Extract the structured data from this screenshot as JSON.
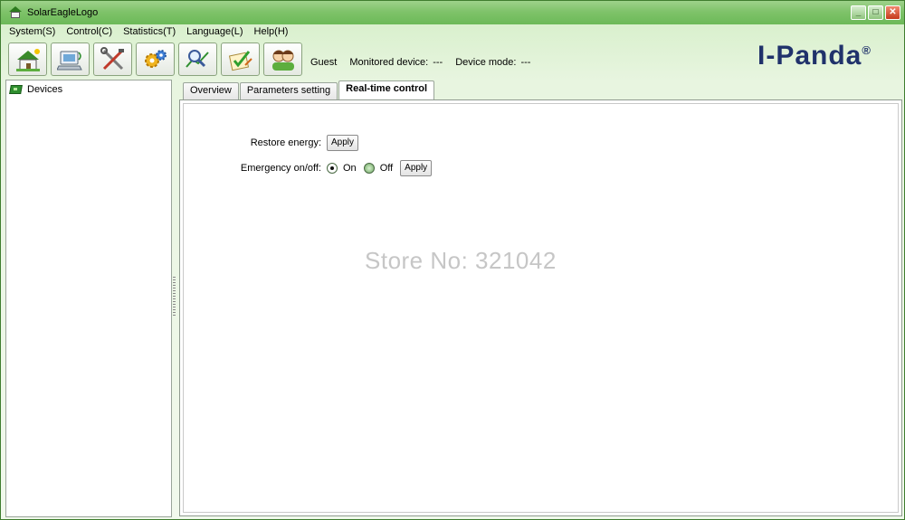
{
  "window": {
    "title": "SolarEagleLogo"
  },
  "window_controls": [
    "minimize",
    "maximize",
    "close"
  ],
  "menu": [
    {
      "label": "System(S)"
    },
    {
      "label": "Control(C)"
    },
    {
      "label": "Statistics(T)"
    },
    {
      "label": "Language(L)"
    },
    {
      "label": "Help(H)"
    }
  ],
  "toolbar": [
    {
      "icon": "solar-house-icon"
    },
    {
      "icon": "monitor-device-icon"
    },
    {
      "icon": "tools-icon"
    },
    {
      "icon": "settings-gears-icon"
    },
    {
      "icon": "search-chart-icon"
    },
    {
      "icon": "checklist-icon"
    },
    {
      "icon": "users-icon"
    }
  ],
  "status": {
    "user": "Guest",
    "monitored_label": "Monitored device:",
    "monitored_value": "---",
    "mode_label": "Device mode:",
    "mode_value": "---"
  },
  "brand": {
    "name": "I-Panda",
    "mark": "®"
  },
  "tree": {
    "root_label": "Devices"
  },
  "tabs": [
    {
      "label": "Overview",
      "active": false
    },
    {
      "label": "Parameters setting",
      "active": false
    },
    {
      "label": "Real-time control",
      "active": true
    }
  ],
  "controls": {
    "restore_energy_label": "Restore energy:",
    "restore_apply": "Apply",
    "emergency_label": "Emergency on/off:",
    "on_label": "On",
    "off_label": "Off",
    "emergency_selected": "On",
    "emergency_apply": "Apply"
  },
  "watermark": "Store No: 321042",
  "colors": {
    "accent": "#6cb958",
    "brand": "#20326b",
    "title_green": "#7fc36a"
  }
}
